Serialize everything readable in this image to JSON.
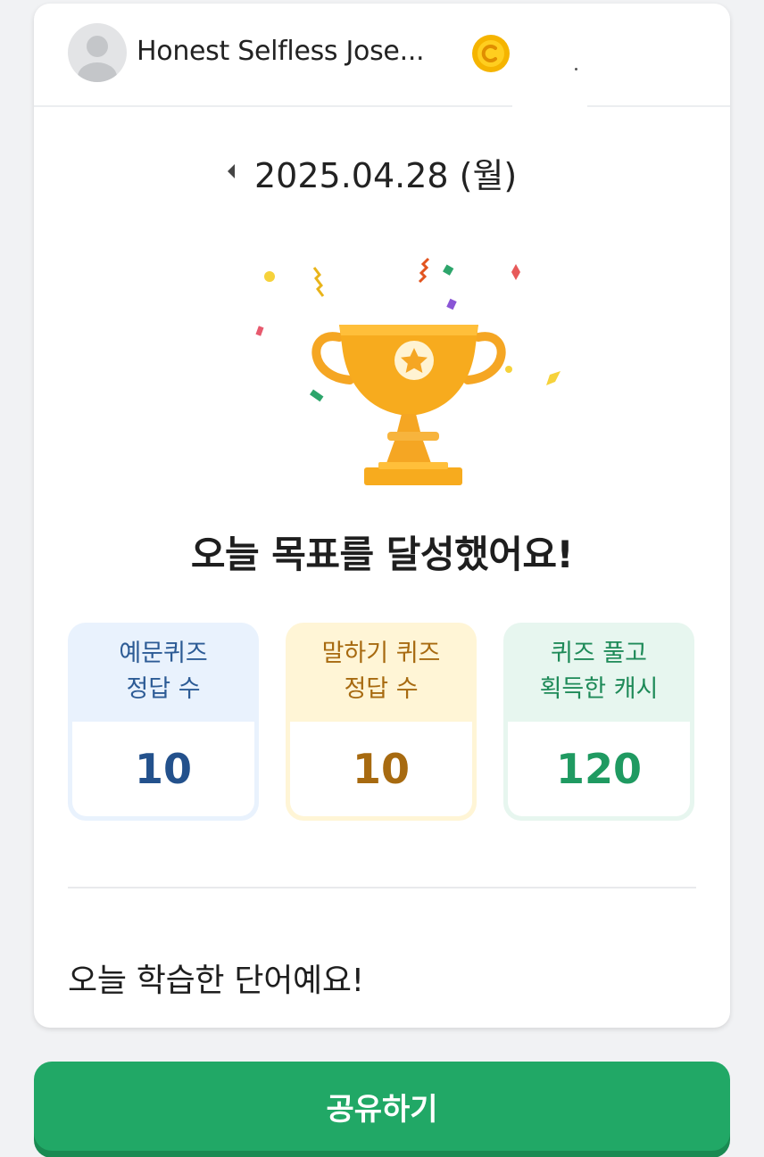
{
  "profile": {
    "username": "Honest Selfless Jose...",
    "coin_icon": "coin-icon",
    "avatar_icon": "default-avatar-icon"
  },
  "date": {
    "prev_icon": "caret-left-icon",
    "label": "2025.04.28 (월)"
  },
  "trophy": {
    "icon": "trophy-icon"
  },
  "headline": "오늘 목표를 달성했어요!",
  "stats": [
    {
      "line1": "예문퀴즈",
      "line2": "정답 수",
      "value": "10",
      "color": "#23518c"
    },
    {
      "line1": "말하기 퀴즈",
      "line2": "정답 수",
      "value": "10",
      "color": "#a76a10"
    },
    {
      "line1": "퀴즈 풀고",
      "line2": "획득한 캐시",
      "value": "120",
      "color": "#1f9a61"
    }
  ],
  "words_title": "오늘 학습한 단어예요!",
  "share_button": "공유하기",
  "colors": {
    "accent_green": "#21a866",
    "trophy_gold": "#f5a623"
  }
}
